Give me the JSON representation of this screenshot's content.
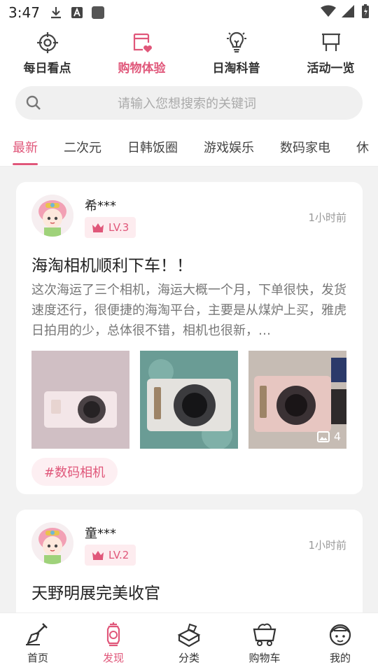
{
  "status_bar": {
    "time": "3:47"
  },
  "top_nav": [
    {
      "label": "每日看点",
      "icon": "crosshair-icon",
      "active": false
    },
    {
      "label": "购物体验",
      "icon": "cart-heart-icon",
      "active": true
    },
    {
      "label": "日淘科普",
      "icon": "lightbulb-icon",
      "active": false
    },
    {
      "label": "活动一览",
      "icon": "billboard-icon",
      "active": false
    }
  ],
  "search": {
    "placeholder": "请输入您想搜索的关键词"
  },
  "categories": [
    "最新",
    "二次元",
    "日韩饭圈",
    "游戏娱乐",
    "数码家电",
    "休"
  ],
  "active_category": 0,
  "posts": [
    {
      "username": "希***",
      "level": "LV.3",
      "time": "1小时前",
      "title": "海淘相机顺利下车！！",
      "body": "这次海运了三个相机，海运大概一个月，下单很快，发货速度还行，很便捷的海淘平台，主要是从煤炉上买，雅虎日拍用的少，总体很不错，相机也很新，…",
      "image_count": "4",
      "tag": "#数码相机"
    },
    {
      "username": "童***",
      "level": "LV.2",
      "time": "1小时前",
      "title": "天野明展完美收官"
    }
  ],
  "bottom_nav": [
    {
      "label": "首页",
      "icon": "shovel-icon"
    },
    {
      "label": "发现",
      "icon": "lantern-icon"
    },
    {
      "label": "分类",
      "icon": "crate-icon"
    },
    {
      "label": "购物车",
      "icon": "mine-cart-icon"
    },
    {
      "label": "我的",
      "icon": "profile-face-icon"
    }
  ],
  "colors": {
    "accent": "#e0577a",
    "tag_bg": "#fdeff2",
    "page_bg": "#f2f2f2"
  }
}
